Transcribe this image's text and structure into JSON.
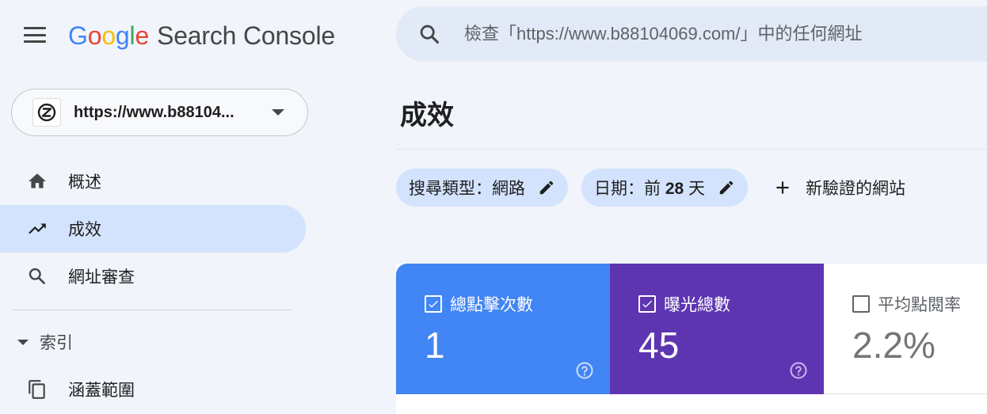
{
  "header": {
    "logo_letters": [
      "G",
      "o",
      "o",
      "g",
      "l",
      "e"
    ],
    "product_name": "Search Console",
    "search_placeholder": "檢查「https://www.b88104069.com/」中的任何網址"
  },
  "property": {
    "url": "https://www.b88104..."
  },
  "sidebar": {
    "items": [
      {
        "label": "概述",
        "icon": "home-icon"
      },
      {
        "label": "成效",
        "icon": "trending-up-icon",
        "active": true
      },
      {
        "label": "網址審查",
        "icon": "search-icon"
      }
    ],
    "section": {
      "label": "索引"
    },
    "section_items": [
      {
        "label": "涵蓋範圍",
        "icon": "copy-pages-icon"
      }
    ]
  },
  "main": {
    "title": "成效",
    "chips": [
      {
        "label": "搜尋類型：網路"
      },
      {
        "label_prefix": "日期：前 ",
        "label_bold": "28",
        "label_suffix": " 天"
      }
    ],
    "add_button_label": "新驗證的網站",
    "metrics": [
      {
        "label": "總點擊次數",
        "value": "1",
        "checked": true,
        "color": "#4285f4"
      },
      {
        "label": "曝光總數",
        "value": "45",
        "checked": true,
        "color": "#5e35b1"
      },
      {
        "label": "平均點閱率",
        "value": "2.2%",
        "checked": false,
        "color": "#ffffff"
      }
    ]
  },
  "colors": {
    "page_bg": "#f1f4fb",
    "active_nav": "#d3e3fd",
    "chip_bg": "#d3e3fd"
  }
}
